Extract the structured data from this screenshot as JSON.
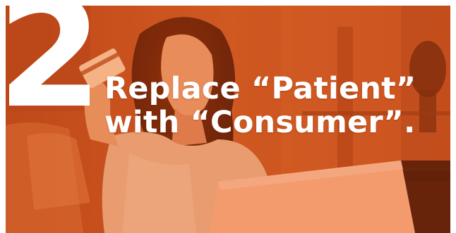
{
  "slide": {
    "step_number": "2",
    "headline_line_1": "Replace “Patient”",
    "headline_line_2": "with “Consumer”."
  },
  "colors": {
    "overlay": "#c8521e",
    "text": "#ffffff"
  },
  "photo": {
    "subject": "woman-holding-credit-card-with-laptop"
  }
}
